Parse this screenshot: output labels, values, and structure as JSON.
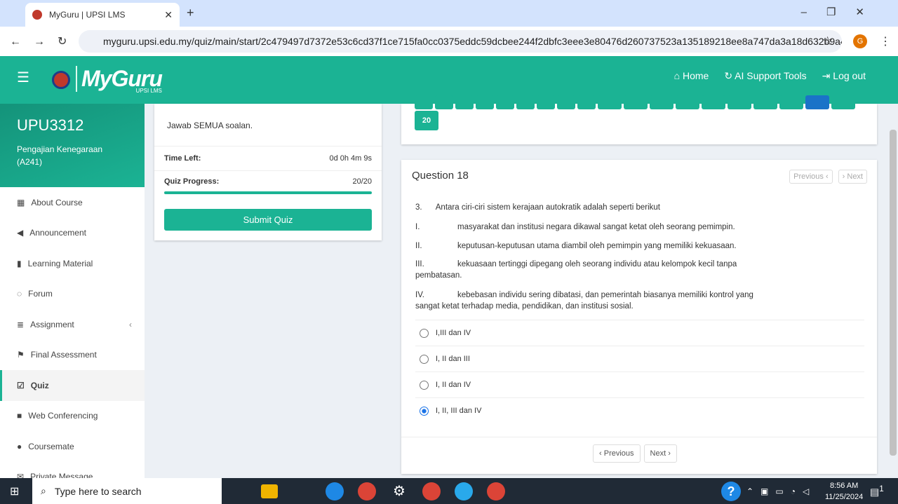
{
  "browser": {
    "tab_title": "MyGuru | UPSI LMS",
    "url": "myguru.upsi.edu.my/quiz/main/start/2c479497d7372e53c6cd37f1ce715fa0cc0375eddc59dcbee244f2dbfc3eee3e80476d260737523a135189218ee8a747da3a18d632b9a4eae...",
    "profile_initial": "G"
  },
  "header": {
    "brand": "MyGuru",
    "sub": "UPSI LMS",
    "links": [
      {
        "label": "Home",
        "icon": "home-icon"
      },
      {
        "label": "AI Support Tools",
        "icon": "refresh-icon"
      },
      {
        "label": "Log out",
        "icon": "logout-icon"
      }
    ]
  },
  "course": {
    "code": "UPU3312",
    "name": "Pengajian Kenegaraan (A241)"
  },
  "sidebar": {
    "items": [
      {
        "label": "About Course",
        "icon": "grid"
      },
      {
        "label": "Announcement",
        "icon": "bullhorn"
      },
      {
        "label": "Learning Material",
        "icon": "book"
      },
      {
        "label": "Forum",
        "icon": "comments"
      },
      {
        "label": "Assignment",
        "icon": "list"
      },
      {
        "label": "Final Assessment",
        "icon": "flag"
      },
      {
        "label": "Quiz",
        "icon": "check-square",
        "active": true
      },
      {
        "label": "Web Conferencing",
        "icon": "video"
      },
      {
        "label": "Coursemate",
        "icon": "users"
      },
      {
        "label": "Private Message",
        "icon": "envelope"
      }
    ]
  },
  "quiz": {
    "instruction": "Jawab SEMUA soalan.",
    "time_left_label": "Time Left:",
    "time_left": "0d 0h 4m 9s",
    "progress_label": "Quiz Progress:",
    "progress": "20/20",
    "progress_fraction": 1.0,
    "submit_label": "Submit Quiz",
    "last_tile": "20",
    "current_tile": 18,
    "accent": "#1bb394",
    "current_color": "#1a73c8"
  },
  "question": {
    "title": "Question 18",
    "prev": "Previous",
    "next": "Next",
    "number": "3.",
    "stem": "Antara ciri-ciri sistem kerajaan autokratik adalah seperti berikut",
    "statements": [
      {
        "n": "I.",
        "t": "masyarakat dan institusi negara dikawal sangat ketat oleh seorang pemimpin."
      },
      {
        "n": "II.",
        "t": "keputusan-keputusan utama diambil oleh pemimpin yang memiliki kekuasaan."
      },
      {
        "n": "III.",
        "t": "kekuasaan tertinggi dipegang oleh seorang individu atau kelompok kecil tanpa",
        "c": "pembatasan."
      },
      {
        "n": "IV.",
        "t": "kebebasan individu sering dibatasi, dan pemerintah biasanya memiliki kontrol yang",
        "c": "sangat ketat terhadap media, pendidikan, dan institusi sosial."
      }
    ],
    "options": [
      "I,III dan IV",
      "I, II dan III",
      "I, II dan IV",
      "I, II, III dan IV"
    ],
    "selected": 3
  },
  "taskbar": {
    "search_placeholder": "Type here to search",
    "time": "8:56 AM",
    "date": "11/25/2024",
    "notifications": "1"
  }
}
